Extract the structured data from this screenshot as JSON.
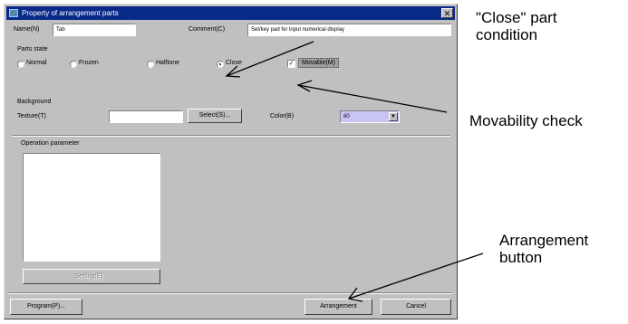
{
  "dialog": {
    "title": "Property of arrangement parts",
    "close_glyph": "✕",
    "name_label": "Name(N)",
    "name_value": "Tab",
    "comment_label": "Comment(C)",
    "comment_value": "Set/key pad for input numerical display",
    "parts_state": {
      "group_label": "Parts state",
      "options": [
        "Normal",
        "Frozen",
        "Halftone",
        "Close"
      ],
      "selected": "Close",
      "movable_label": "Movable(M)",
      "movable_checked": true
    },
    "background": {
      "group_label": "Background",
      "texture_label": "Texture(T)",
      "texture_value": "",
      "select_label": "Select(S)...",
      "color_label": "Color(B)",
      "color_value": "60",
      "combo_arrow": "▼"
    },
    "operation": {
      "group_label": "Operation parameter",
      "setting_button_label": "Setting(E)..."
    },
    "footer": {
      "program_label": "Program(P)...",
      "arrangement_label": "Arrangement",
      "cancel_label": "Cancel"
    }
  },
  "annotations": {
    "close_part_condition": [
      "\"Close\" part",
      "condition"
    ],
    "movability_check": "Movability check",
    "arrangement_button": [
      "Arrangement",
      "button"
    ]
  }
}
